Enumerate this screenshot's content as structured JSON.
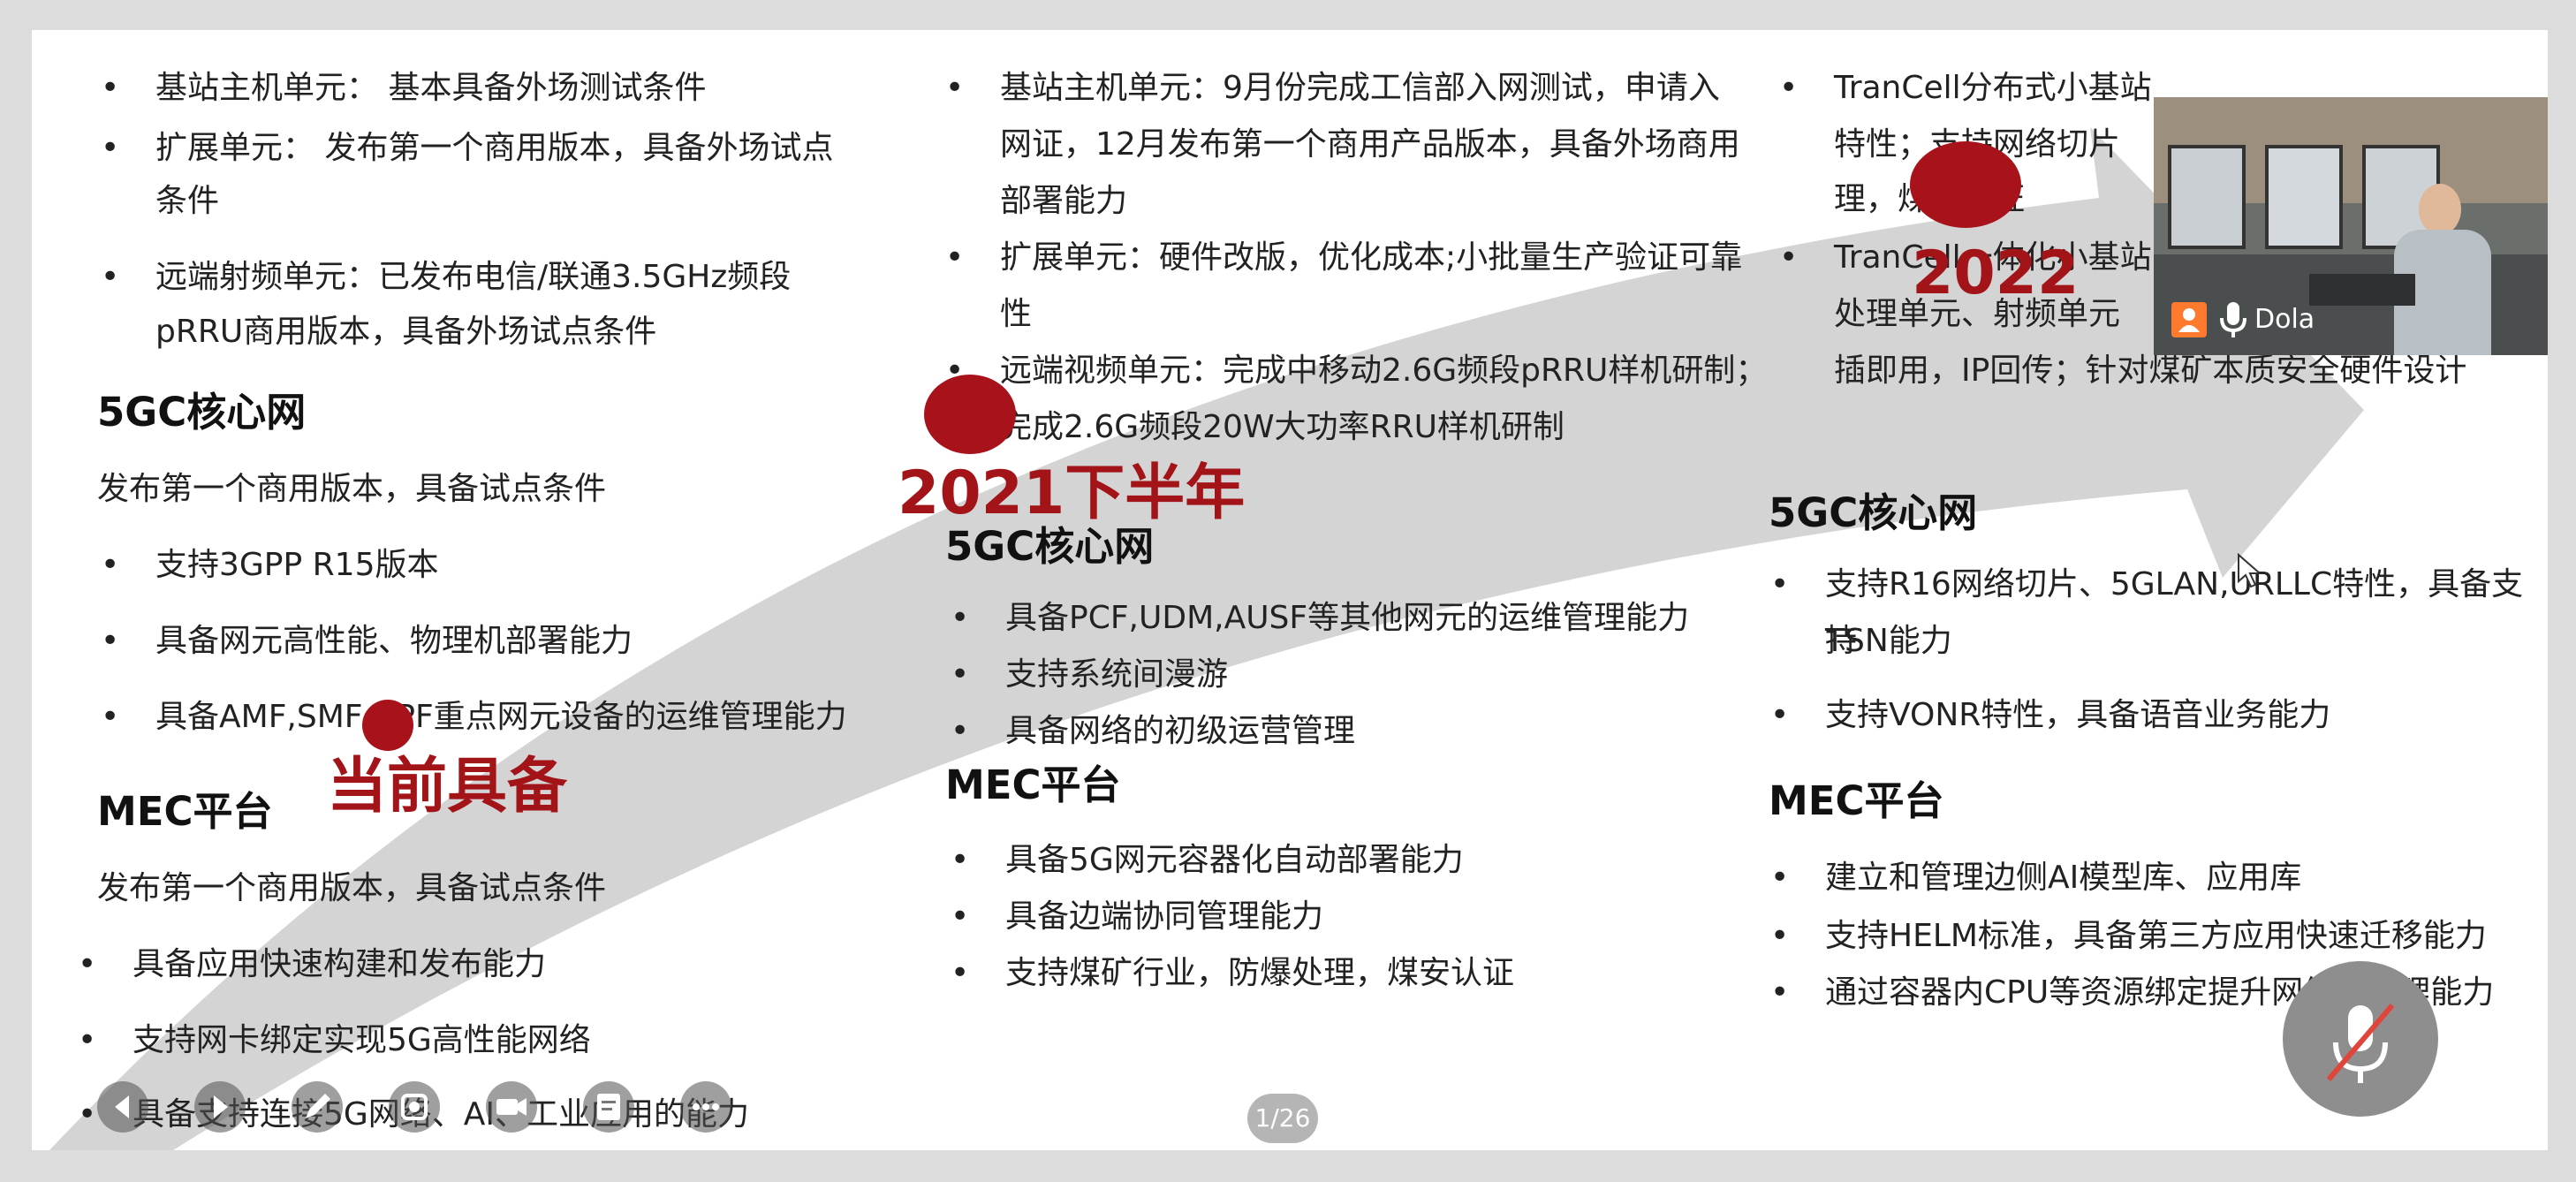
{
  "col1": {
    "items_top": [
      "基站主机单元：  基本具备外场测试条件",
      "扩展单元：  发布第一个商用版本，具备外场试点",
      "条件",
      "远端射频单元：已发布电信/联通3.5GHz频段",
      "pRRU商用版本，具备外场试点条件"
    ],
    "core_title": "5GC核心网",
    "core_intro": "发布第一个商用版本，具备试点条件",
    "core_items": [
      "支持3GPP R15版本",
      "具备网元高性能、物理机部署能力",
      "具备AMF,SMF,UPF重点网元设备的运维管理能力"
    ],
    "milestone": "当前具备",
    "mec_title": "MEC平台",
    "mec_intro": "发布第一个商用版本，具备试点条件",
    "mec_items": [
      "具备应用快速构建和发布能力",
      "支持网卡绑定实现5G高性能网络",
      "具备支持连接5G网络、AI、工业应用的能力"
    ]
  },
  "col2": {
    "items_top": [
      "基站主机单元：9月份完成工信部入网测试，申请入",
      "网证，12月发布第一个商用产品版本，具备外场商用",
      "部署能力",
      "扩展单元：硬件改版，优化成本;小批量生产验证可靠",
      "性",
      "远端视频单元：完成中移动2.6G频段pRRU样机研制；",
      "完成2.6G频段20W大功率RRU样机研制"
    ],
    "milestone": "2021下半年",
    "core_title": "5GC核心网",
    "core_items": [
      "具备PCF,UDM,AUSF等其他网元的运维管理能力",
      "支持系统间漫游",
      "具备网络的初级运营管理"
    ],
    "mec_title": "MEC平台",
    "mec_items": [
      "具备5G网元容器化自动部署能力",
      "具备边端协同管理能力",
      "支持煤矿行业，防爆处理，煤安认证"
    ]
  },
  "col3": {
    "items_top": [
      "TranCell分布式小基站",
      "特性；支持网络切片",
      "理，煤安认证",
      "TranCell一体化小基站",
      "处理单元、射频单元",
      "插即用，IP回传；针对煤矿本质安全硬件设计"
    ],
    "milestone": "2022",
    "core_title": "5GC核心网",
    "core_items": [
      "支持R16网络切片、5GLAN,URLLC特性，具备支持",
      "TSN能力",
      "支持VONR特性，具备语音业务能力"
    ],
    "mec_title": "MEC平台",
    "mec_items": [
      "建立和管理边侧AI模型库、应用库",
      "支持HELM标准，具备第三方应用快速迁移能力",
      "通过容器内CPU等资源绑定提升网络和处理能力"
    ]
  },
  "video": {
    "name": "Dola"
  },
  "page_indicator": "1/26",
  "colors": {
    "accent": "#a31419",
    "arrow": "#cfcfcf"
  }
}
